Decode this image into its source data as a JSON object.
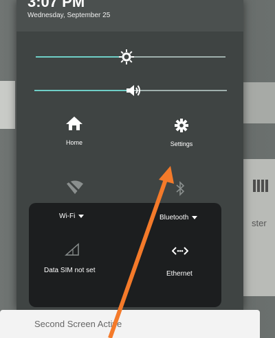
{
  "status": {
    "clock": "3:07 PM",
    "date": "Wednesday, September 25"
  },
  "sliders": {
    "brightness_level": 0.48,
    "volume_level": 0.51
  },
  "tiles": {
    "home": {
      "label": "Home",
      "icon": "home-icon"
    },
    "settings": {
      "label": "Settings",
      "icon": "gear-icon"
    },
    "wifi": {
      "label": "Wi-Fi",
      "icon": "wifi-off-icon"
    },
    "bluetooth": {
      "label": "Bluetooth",
      "icon": "bluetooth-icon"
    },
    "sim": {
      "label": "Data SIM not set",
      "icon": "signal-icon"
    },
    "ethernet": {
      "label": "Ethernet",
      "icon": "ethernet-icon"
    }
  },
  "background": {
    "right_text": "ster"
  },
  "sheet": {
    "text": "Second Screen Active"
  },
  "colors": {
    "panel": "#3f4443",
    "slider_fill": "#6fcfc7",
    "arrow": "#f47a2a"
  }
}
